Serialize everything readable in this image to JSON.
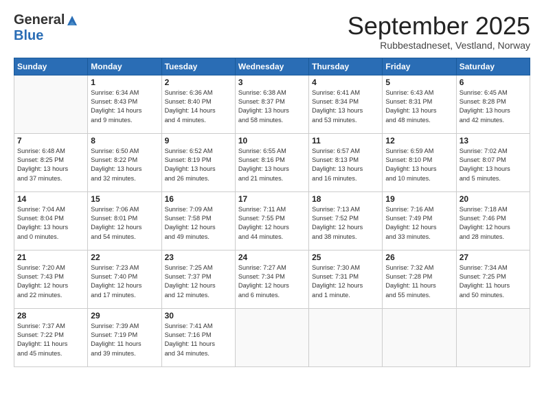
{
  "logo": {
    "general": "General",
    "blue": "Blue"
  },
  "title": "September 2025",
  "subtitle": "Rubbestadneset, Vestland, Norway",
  "days_header": [
    "Sunday",
    "Monday",
    "Tuesday",
    "Wednesday",
    "Thursday",
    "Friday",
    "Saturday"
  ],
  "weeks": [
    [
      {
        "day": "",
        "info": ""
      },
      {
        "day": "1",
        "info": "Sunrise: 6:34 AM\nSunset: 8:43 PM\nDaylight: 14 hours\nand 9 minutes."
      },
      {
        "day": "2",
        "info": "Sunrise: 6:36 AM\nSunset: 8:40 PM\nDaylight: 14 hours\nand 4 minutes."
      },
      {
        "day": "3",
        "info": "Sunrise: 6:38 AM\nSunset: 8:37 PM\nDaylight: 13 hours\nand 58 minutes."
      },
      {
        "day": "4",
        "info": "Sunrise: 6:41 AM\nSunset: 8:34 PM\nDaylight: 13 hours\nand 53 minutes."
      },
      {
        "day": "5",
        "info": "Sunrise: 6:43 AM\nSunset: 8:31 PM\nDaylight: 13 hours\nand 48 minutes."
      },
      {
        "day": "6",
        "info": "Sunrise: 6:45 AM\nSunset: 8:28 PM\nDaylight: 13 hours\nand 42 minutes."
      }
    ],
    [
      {
        "day": "7",
        "info": "Sunrise: 6:48 AM\nSunset: 8:25 PM\nDaylight: 13 hours\nand 37 minutes."
      },
      {
        "day": "8",
        "info": "Sunrise: 6:50 AM\nSunset: 8:22 PM\nDaylight: 13 hours\nand 32 minutes."
      },
      {
        "day": "9",
        "info": "Sunrise: 6:52 AM\nSunset: 8:19 PM\nDaylight: 13 hours\nand 26 minutes."
      },
      {
        "day": "10",
        "info": "Sunrise: 6:55 AM\nSunset: 8:16 PM\nDaylight: 13 hours\nand 21 minutes."
      },
      {
        "day": "11",
        "info": "Sunrise: 6:57 AM\nSunset: 8:13 PM\nDaylight: 13 hours\nand 16 minutes."
      },
      {
        "day": "12",
        "info": "Sunrise: 6:59 AM\nSunset: 8:10 PM\nDaylight: 13 hours\nand 10 minutes."
      },
      {
        "day": "13",
        "info": "Sunrise: 7:02 AM\nSunset: 8:07 PM\nDaylight: 13 hours\nand 5 minutes."
      }
    ],
    [
      {
        "day": "14",
        "info": "Sunrise: 7:04 AM\nSunset: 8:04 PM\nDaylight: 13 hours\nand 0 minutes."
      },
      {
        "day": "15",
        "info": "Sunrise: 7:06 AM\nSunset: 8:01 PM\nDaylight: 12 hours\nand 54 minutes."
      },
      {
        "day": "16",
        "info": "Sunrise: 7:09 AM\nSunset: 7:58 PM\nDaylight: 12 hours\nand 49 minutes."
      },
      {
        "day": "17",
        "info": "Sunrise: 7:11 AM\nSunset: 7:55 PM\nDaylight: 12 hours\nand 44 minutes."
      },
      {
        "day": "18",
        "info": "Sunrise: 7:13 AM\nSunset: 7:52 PM\nDaylight: 12 hours\nand 38 minutes."
      },
      {
        "day": "19",
        "info": "Sunrise: 7:16 AM\nSunset: 7:49 PM\nDaylight: 12 hours\nand 33 minutes."
      },
      {
        "day": "20",
        "info": "Sunrise: 7:18 AM\nSunset: 7:46 PM\nDaylight: 12 hours\nand 28 minutes."
      }
    ],
    [
      {
        "day": "21",
        "info": "Sunrise: 7:20 AM\nSunset: 7:43 PM\nDaylight: 12 hours\nand 22 minutes."
      },
      {
        "day": "22",
        "info": "Sunrise: 7:23 AM\nSunset: 7:40 PM\nDaylight: 12 hours\nand 17 minutes."
      },
      {
        "day": "23",
        "info": "Sunrise: 7:25 AM\nSunset: 7:37 PM\nDaylight: 12 hours\nand 12 minutes."
      },
      {
        "day": "24",
        "info": "Sunrise: 7:27 AM\nSunset: 7:34 PM\nDaylight: 12 hours\nand 6 minutes."
      },
      {
        "day": "25",
        "info": "Sunrise: 7:30 AM\nSunset: 7:31 PM\nDaylight: 12 hours\nand 1 minute."
      },
      {
        "day": "26",
        "info": "Sunrise: 7:32 AM\nSunset: 7:28 PM\nDaylight: 11 hours\nand 55 minutes."
      },
      {
        "day": "27",
        "info": "Sunrise: 7:34 AM\nSunset: 7:25 PM\nDaylight: 11 hours\nand 50 minutes."
      }
    ],
    [
      {
        "day": "28",
        "info": "Sunrise: 7:37 AM\nSunset: 7:22 PM\nDaylight: 11 hours\nand 45 minutes."
      },
      {
        "day": "29",
        "info": "Sunrise: 7:39 AM\nSunset: 7:19 PM\nDaylight: 11 hours\nand 39 minutes."
      },
      {
        "day": "30",
        "info": "Sunrise: 7:41 AM\nSunset: 7:16 PM\nDaylight: 11 hours\nand 34 minutes."
      },
      {
        "day": "",
        "info": ""
      },
      {
        "day": "",
        "info": ""
      },
      {
        "day": "",
        "info": ""
      },
      {
        "day": "",
        "info": ""
      }
    ]
  ]
}
